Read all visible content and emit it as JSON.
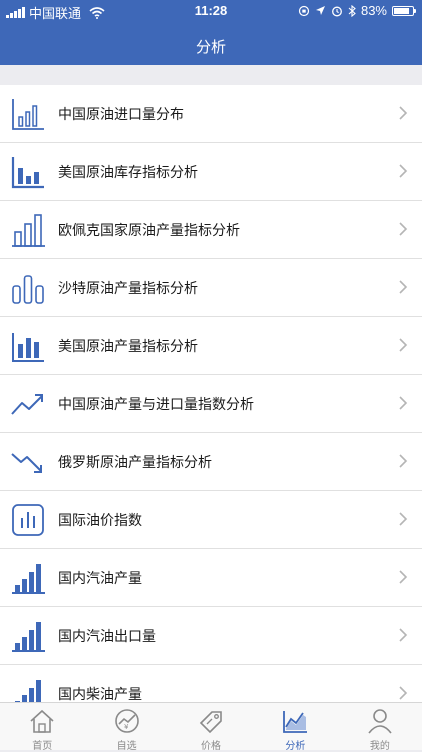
{
  "status": {
    "carrier": "中国联通",
    "time": "11:28",
    "battery": "83%",
    "battery_level": 0.83
  },
  "nav": {
    "title": "分析"
  },
  "list": {
    "items": [
      {
        "label": "中国原油进口量分布",
        "icon": "bar-chart-outline-icon"
      },
      {
        "label": "美国原油库存指标分析",
        "icon": "bar-chart-solid-icon"
      },
      {
        "label": "欧佩克国家原油产量指标分析",
        "icon": "bar-chart-ascending-outline-icon"
      },
      {
        "label": "沙特原油产量指标分析",
        "icon": "bar-chart-rounded-outline-icon"
      },
      {
        "label": "美国原油产量指标分析",
        "icon": "bar-chart-solid-icon"
      },
      {
        "label": "中国原油产量与进口量指数分析",
        "icon": "trend-up-icon"
      },
      {
        "label": "俄罗斯原油产量指标分析",
        "icon": "trend-down-icon"
      },
      {
        "label": "国际油价指数",
        "icon": "bar-chart-boxed-icon"
      },
      {
        "label": "国内汽油产量",
        "icon": "bar-chart-ascending-solid-icon"
      },
      {
        "label": "国内汽油出口量",
        "icon": "bar-chart-ascending-solid-icon"
      },
      {
        "label": "国内柴油产量",
        "icon": "bar-chart-ascending-solid-icon"
      }
    ]
  },
  "tabbar": {
    "tabs": [
      {
        "label": "首页",
        "icon": "home-icon",
        "active": false
      },
      {
        "label": "自选",
        "icon": "favorites-icon",
        "active": false
      },
      {
        "label": "价格",
        "icon": "price-tag-icon",
        "active": false
      },
      {
        "label": "分析",
        "icon": "analysis-chart-icon",
        "active": true
      },
      {
        "label": "我的",
        "icon": "profile-icon",
        "active": false
      }
    ]
  },
  "colors": {
    "accent": "#3e68b8",
    "inactive": "#8a8a8a"
  }
}
